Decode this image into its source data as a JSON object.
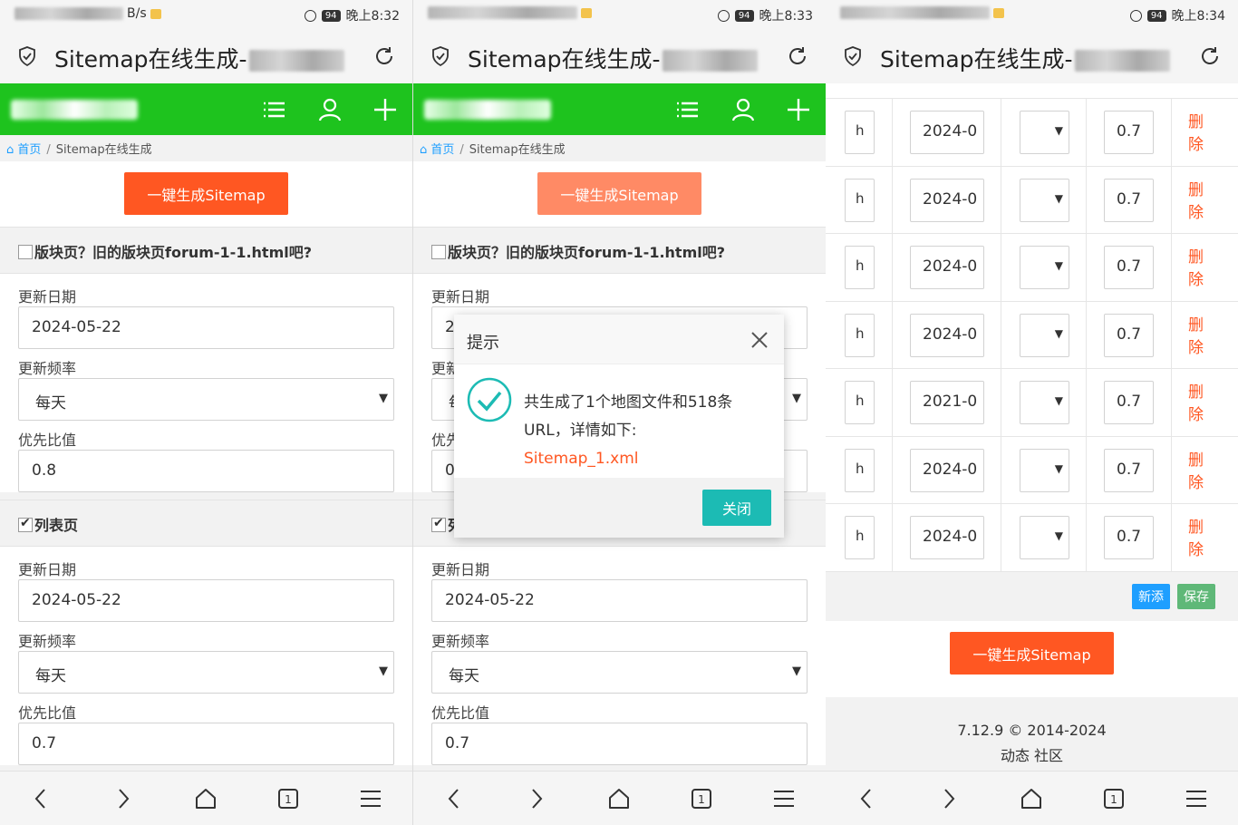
{
  "panels": [
    {
      "status_time": "晚上8:32",
      "status_speed": "B/s",
      "battery": "94"
    },
    {
      "status_time": "晚上8:33",
      "status_speed": "",
      "battery": "94"
    },
    {
      "status_time": "晚上8:34",
      "status_speed": "",
      "battery": "94"
    }
  ],
  "browser": {
    "title": "Sitemap在线生成-"
  },
  "breadcrumb": {
    "home": "首页",
    "separator": "/",
    "current": "Sitemap在线生成"
  },
  "generate_button": "一键生成Sitemap",
  "forum_section": {
    "title": "版块页？旧的版块页forum-1-1.html吧?",
    "checked": false,
    "date_label": "更新日期",
    "date_value": "2024-05-22",
    "freq_label": "更新频率",
    "freq_value": "每天",
    "priority_label": "优先比值",
    "priority_value": "0.8"
  },
  "list_section": {
    "title": "列表页",
    "checked": true,
    "date_label": "更新日期",
    "date_value": "2024-05-22",
    "freq_label": "更新频率",
    "freq_value": "每天",
    "priority_label": "优先比值",
    "priority_value": "0.7"
  },
  "dialog": {
    "title": "提示",
    "message_line1": "共生成了1个地图文件和518条",
    "message_line2": "URL，详情如下:",
    "link": "Sitemap_1.xml",
    "ok": "关闭"
  },
  "table_rows": [
    {
      "url": "h",
      "date": "2024-0",
      "freq": "",
      "priority": "0.7",
      "delete": "删除"
    },
    {
      "url": "h",
      "date": "2024-0",
      "freq": "",
      "priority": "0.7",
      "delete": "删除"
    },
    {
      "url": "h",
      "date": "2024-0",
      "freq": "",
      "priority": "0.7",
      "delete": "删除"
    },
    {
      "url": "h",
      "date": "2024-0",
      "freq": "",
      "priority": "0.7",
      "delete": "删除"
    },
    {
      "url": "h",
      "date": "2021-0",
      "freq": "",
      "priority": "0.7",
      "delete": "删除"
    },
    {
      "url": "h",
      "date": "2024-0",
      "freq": "",
      "priority": "0.7",
      "delete": "删除"
    },
    {
      "url": "h",
      "date": "2024-0",
      "freq": "",
      "priority": "0.7",
      "delete": "删除"
    }
  ],
  "table_actions": {
    "add": "新添",
    "save": "保存"
  },
  "footer": {
    "version": "7.12.9 © 2014-2024",
    "links": "动态 社区"
  },
  "colors": {
    "header_green": "#1ec31e",
    "accent_orange": "#ff5722",
    "teal": "#1cbbb4",
    "blue": "#1e9fff",
    "green_btn": "#5fb878"
  },
  "icons": [
    "shield-icon",
    "reload-icon",
    "list-icon",
    "user-icon",
    "plus-icon",
    "back-icon",
    "forward-icon",
    "home-icon",
    "tabs-icon",
    "menu-icon",
    "close-icon",
    "check-circle-icon",
    "alarm-icon"
  ]
}
